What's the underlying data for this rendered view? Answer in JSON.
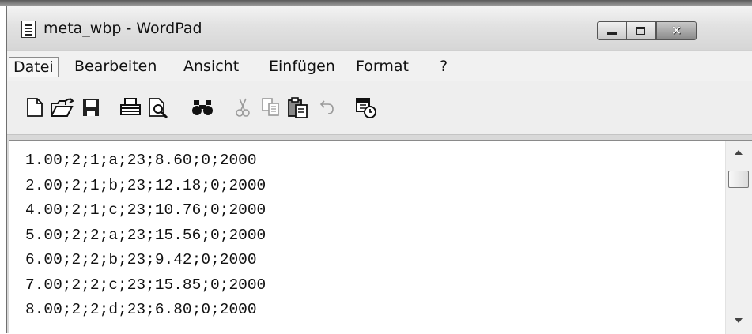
{
  "window": {
    "title": "meta_wbp - WordPad"
  },
  "menu": {
    "items": [
      "Datei",
      "Bearbeiten",
      "Ansicht",
      "Einfügen",
      "Format",
      "?"
    ]
  },
  "toolbar": {
    "buttons": [
      "new-document-icon",
      "open-icon",
      "save-icon",
      "print-icon",
      "print-preview-icon",
      "find-icon",
      "cut-icon",
      "copy-icon",
      "paste-icon",
      "undo-icon",
      "insert-date-time-icon"
    ]
  },
  "document": {
    "lines": [
      "1.00;2;1;a;23;8.60;0;2000",
      "2.00;2;1;b;23;12.18;0;2000",
      "4.00;2;1;c;23;10.76;0;2000",
      "5.00;2;2;a;23;15.56;0;2000",
      "6.00;2;2;b;23;9.42;0;2000",
      "7.00;2;2;c;23;15.85;0;2000",
      "8.00;2;2;d;23;6.80;0;2000"
    ]
  }
}
